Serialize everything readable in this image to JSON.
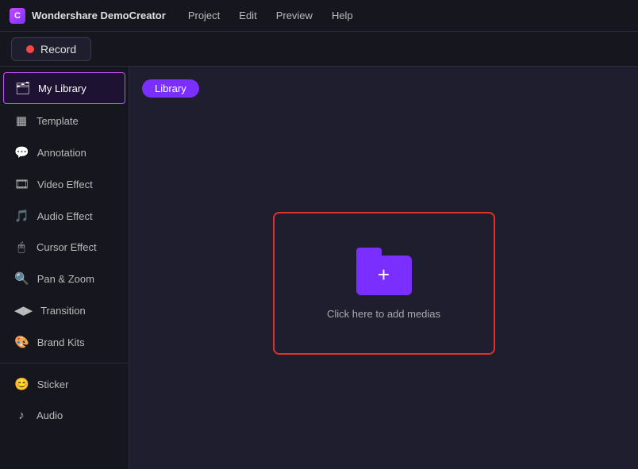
{
  "app": {
    "title": "Wondershare DemoCreator",
    "logo_text": "C"
  },
  "titlebar": {
    "nav_items": [
      "Project",
      "Edit",
      "Preview",
      "Help"
    ]
  },
  "toolbar": {
    "record_label": "Record"
  },
  "sidebar": {
    "items": [
      {
        "id": "my-library",
        "label": "My Library",
        "icon": "🗂",
        "active": true
      },
      {
        "id": "template",
        "label": "Template",
        "icon": "▦"
      },
      {
        "id": "annotation",
        "label": "Annotation",
        "icon": "💬"
      },
      {
        "id": "video-effect",
        "label": "Video Effect",
        "icon": "🎞"
      },
      {
        "id": "audio-effect",
        "label": "Audio Effect",
        "icon": "🎵"
      },
      {
        "id": "cursor-effect",
        "label": "Cursor Effect",
        "icon": "🖱"
      },
      {
        "id": "pan-zoom",
        "label": "Pan & Zoom",
        "icon": "🔍"
      },
      {
        "id": "transition",
        "label": "Transition",
        "icon": "◀▶"
      },
      {
        "id": "brand-kits",
        "label": "Brand Kits",
        "icon": "🎨"
      },
      {
        "id": "sticker",
        "label": "Sticker",
        "icon": "😊"
      },
      {
        "id": "audio",
        "label": "Audio",
        "icon": "♪"
      }
    ]
  },
  "content": {
    "tab_label": "Library",
    "add_media_text": "Click here to add medias"
  },
  "colors": {
    "accent_purple": "#7b2fff",
    "record_red": "#ff4444",
    "border_red": "#e03030"
  }
}
